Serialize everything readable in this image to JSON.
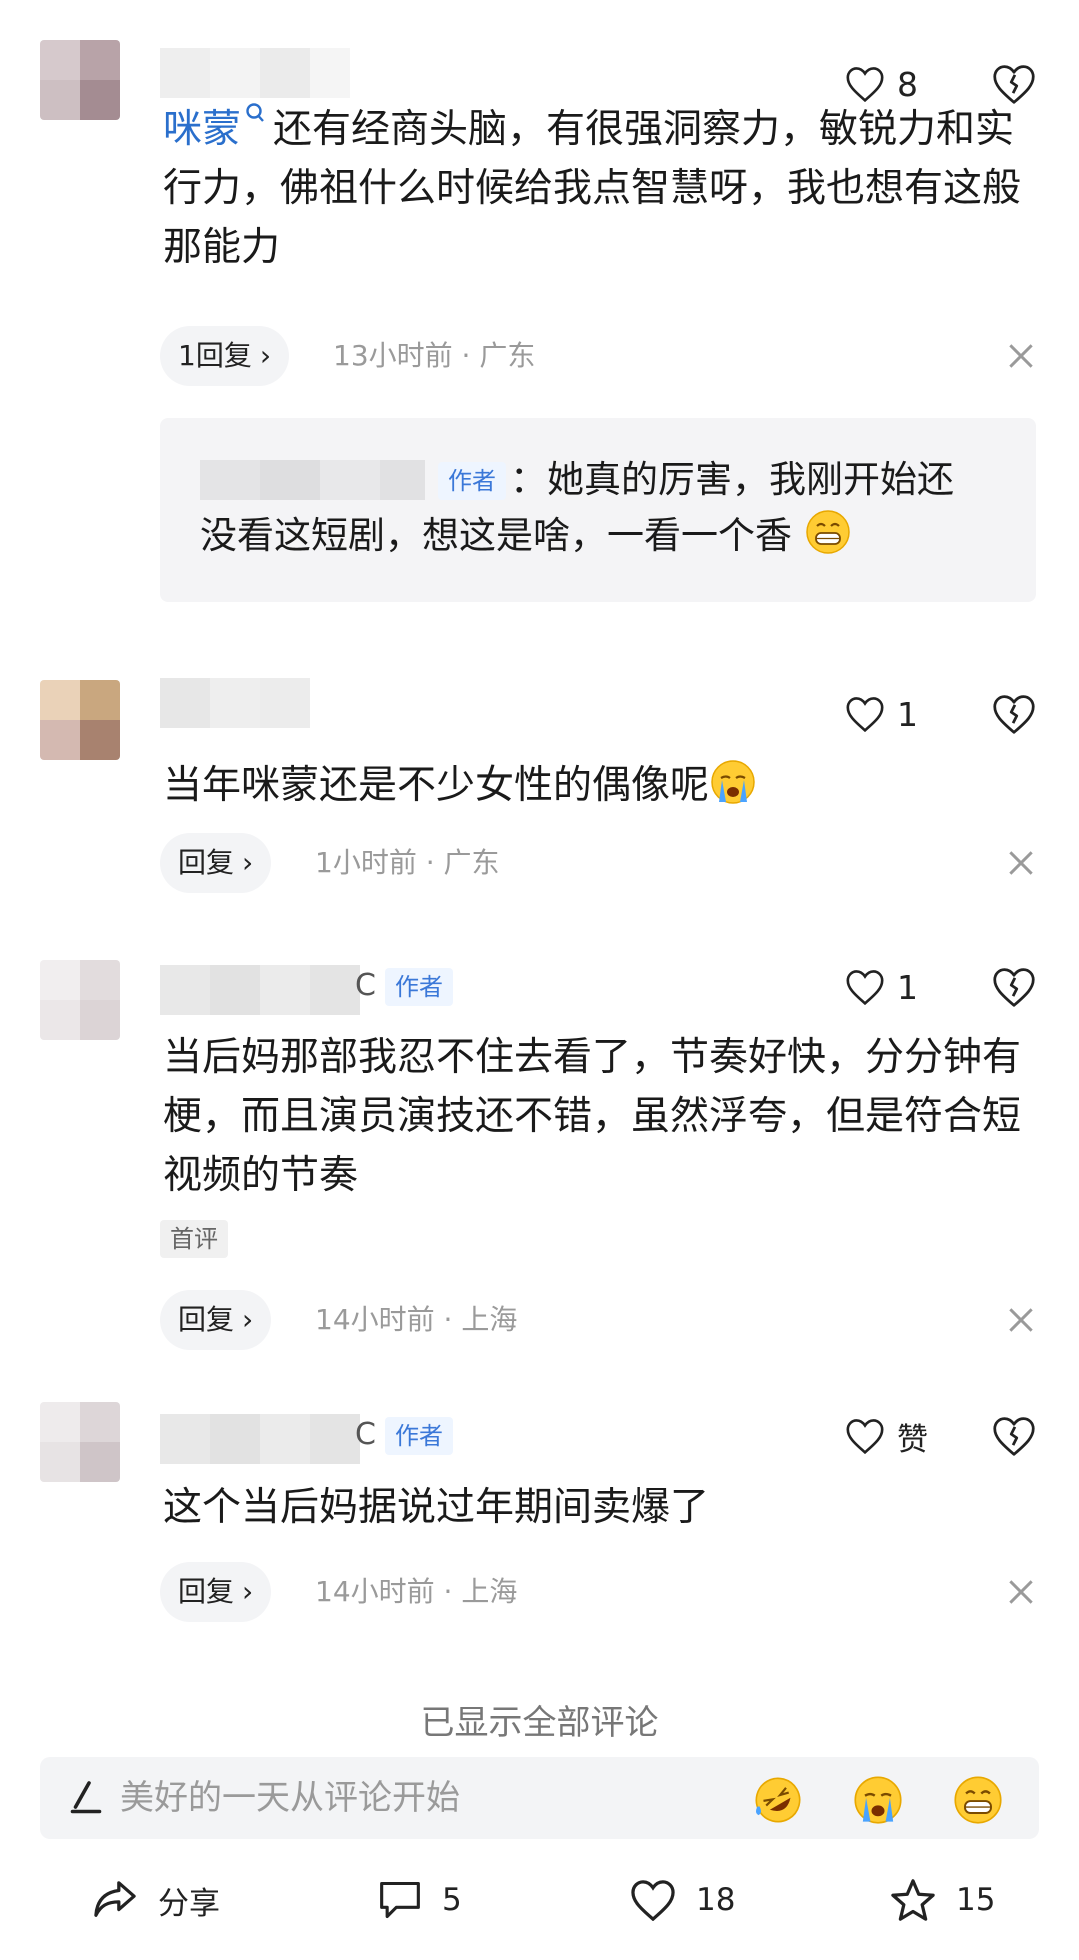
{
  "comments": [
    {
      "mention": "咪蒙",
      "mention_icon": "search-icon",
      "text": "还有经商头脑，有很强洞察力，敏锐力和实行力，佛祖什么时候给我点智慧呀，我也想有这般那能力",
      "likes": "8",
      "reply_label": "1回复",
      "time_location": "13小时前 · 广东",
      "sub_reply": {
        "author_tag": "作者",
        "text_line1": "：她真的厉害，我刚开始还",
        "text_line2": "没看这短剧，想这是啥，一看一个香",
        "emoji": "grinning-face"
      }
    },
    {
      "text": "当年咪蒙还是不少女性的偶像呢",
      "emoji": "crying-face",
      "likes": "1",
      "reply_label": "回复",
      "time_location": "1小时前 · 广东"
    },
    {
      "author_tag": "作者",
      "name_suffix": "Ⅽ",
      "text": "当后妈那部我忍不住去看了，节奏好快，分分钟有梗，而且演员演技还不错，虽然浮夸，但是符合短视频的节奏",
      "badge": "首评",
      "likes": "1",
      "reply_label": "回复",
      "time_location": "14小时前 · 上海"
    },
    {
      "author_tag": "作者",
      "name_suffix": "Ⅽ",
      "text": "这个当后妈据说过年期间卖爆了",
      "likes": "赞",
      "reply_label": "回复",
      "time_location": "14小时前 · 上海"
    }
  ],
  "footer": {
    "all_shown": "已显示全部评论",
    "input_placeholder": "美好的一天从评论开始",
    "emoji_buttons": [
      "rofl-face",
      "crying-face",
      "grinning-face"
    ]
  },
  "bottom_bar": {
    "share_label": "分享",
    "comment_count": "5",
    "like_count": "18",
    "favorite_count": "15"
  },
  "colors": {
    "mention": "#2a6fcc",
    "author_tag_bg": "#eef5ff",
    "author_tag_text": "#3b78d8",
    "meta_text": "#9a9a9a"
  }
}
